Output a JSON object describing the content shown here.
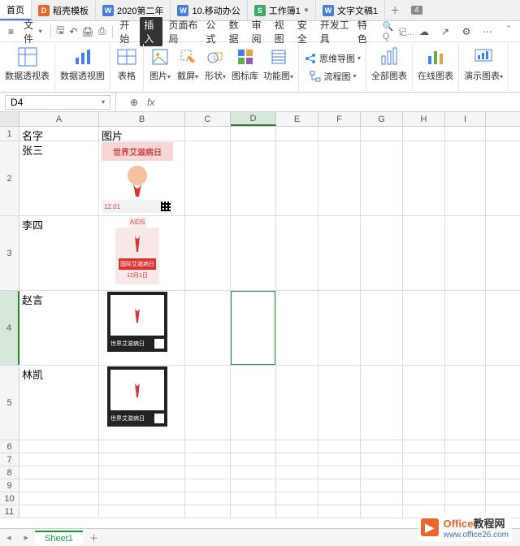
{
  "tabs": [
    {
      "label": "首页",
      "active": true
    },
    {
      "label": "稻壳模板",
      "iconClass": "ic-orange"
    },
    {
      "label": "2020第二年",
      "iconClass": "ic-blue"
    },
    {
      "label": "10.移动办公",
      "iconClass": "ic-blue"
    },
    {
      "label": "工作簿1",
      "iconClass": "ic-green",
      "modified": true
    },
    {
      "label": "文字文稿1",
      "iconClass": "ic-blue"
    }
  ],
  "tab_overflow": "4",
  "toolbar": {
    "menu_btn": "≡",
    "file_label": "文件",
    "menus": [
      "开始",
      "插入",
      "页面布局",
      "公式",
      "数据",
      "审阅",
      "视图",
      "安全",
      "开发工具",
      "特色"
    ],
    "active_menu_index": 1,
    "search_placeholder": "记..."
  },
  "ribbon": {
    "g1": "数据透视表",
    "g2": "数据透视图",
    "g3": "表格",
    "g4": "图片",
    "g5": "截屏",
    "g6": "形状",
    "g7": "图标库",
    "g8": "功能图",
    "g9a": "思维导图",
    "g9b": "流程图",
    "g10": "全部图表",
    "g11": "在线图表",
    "g12": "演示图表"
  },
  "namebox": "D4",
  "fx_label": "fx",
  "columns": [
    "A",
    "B",
    "C",
    "D",
    "E",
    "F",
    "G",
    "H",
    "I"
  ],
  "column_widths": [
    "cw-A",
    "cw-B",
    "cw-C",
    "cw-D",
    "cw-E",
    "cw-F",
    "cw-G",
    "cw-H",
    "cw-I"
  ],
  "header_row": {
    "name": "名字",
    "pic": "图片"
  },
  "data_rows": [
    {
      "num": "2",
      "name": "张三",
      "card": {
        "type": "pink",
        "title": "世界艾滋病日",
        "sub": "12.01"
      }
    },
    {
      "num": "3",
      "name": "李四",
      "card": {
        "type": "pink2",
        "title": "国际艾滋病日",
        "sub": "12月1日"
      }
    },
    {
      "num": "4",
      "name": "赵言",
      "card": {
        "type": "dark",
        "title": "世界艾滋病日"
      }
    },
    {
      "num": "5",
      "name": "林凯",
      "card": {
        "type": "dark",
        "title": "世界艾滋病日"
      }
    }
  ],
  "small_rows": [
    "6",
    "7",
    "8",
    "9",
    "10",
    "11"
  ],
  "active_cell": {
    "col": 3,
    "row_index": 3
  },
  "sheet_tab": "Sheet1",
  "watermark": {
    "brand1": "Office",
    "brand2": "教程网",
    "url": "www.office26.com"
  }
}
